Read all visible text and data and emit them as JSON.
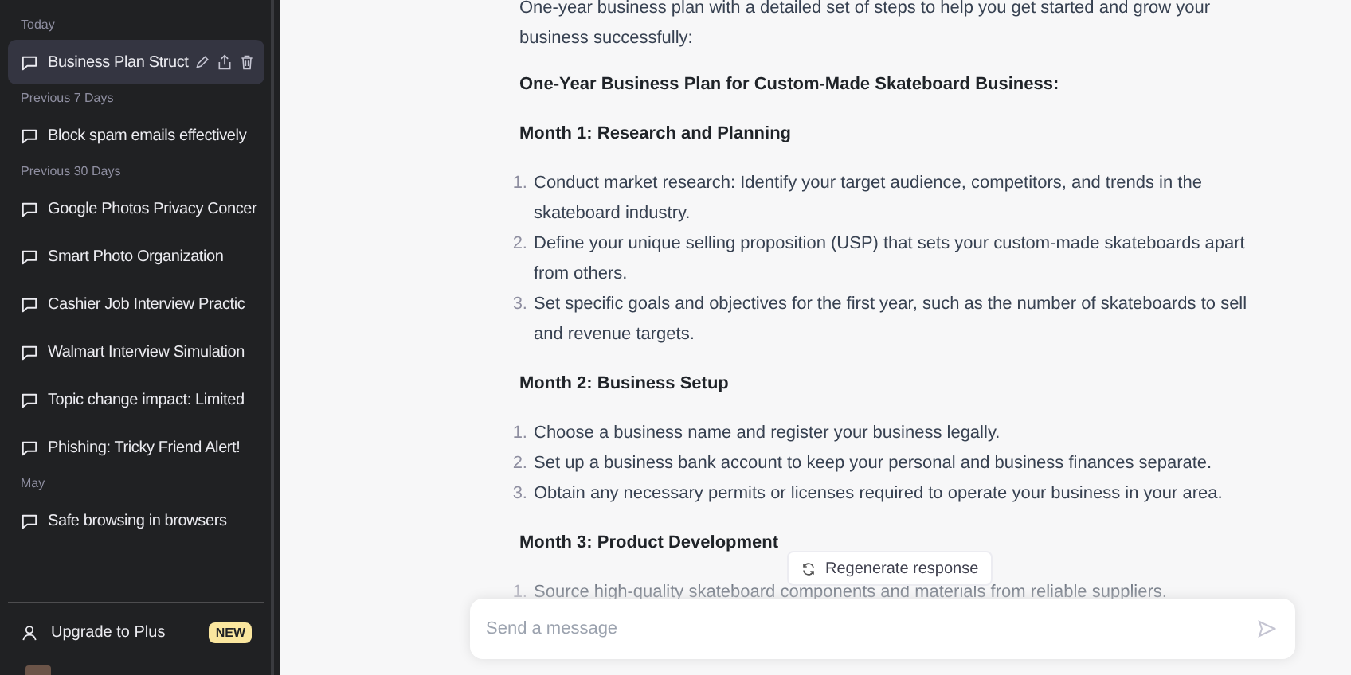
{
  "sidebar": {
    "sections": [
      {
        "label": "Today",
        "items": [
          {
            "title": "Business Plan Struct",
            "selected": true
          }
        ]
      },
      {
        "label": "Previous 7 Days",
        "items": [
          {
            "title": "Block spam emails effectively",
            "selected": false
          }
        ]
      },
      {
        "label": "Previous 30 Days",
        "items": [
          {
            "title": "Google Photos Privacy Concer",
            "selected": false
          },
          {
            "title": "Smart Photo Organization",
            "selected": false
          },
          {
            "title": "Cashier Job Interview Practic",
            "selected": false
          },
          {
            "title": "Walmart Interview Simulation",
            "selected": false
          },
          {
            "title": "Topic change impact: Limited",
            "selected": false
          },
          {
            "title": "Phishing: Tricky Friend Alert!",
            "selected": false
          }
        ]
      },
      {
        "label": "May",
        "items": [
          {
            "title": "Safe browsing in browsers",
            "selected": false
          }
        ]
      }
    ],
    "upgrade": {
      "label": "Upgrade to Plus",
      "badge": "NEW"
    }
  },
  "message": {
    "blocks": [
      {
        "kind": "paragraph",
        "text": "One-year business plan with a detailed set of steps to help you get started and grow your business successfully:"
      },
      {
        "kind": "heading",
        "text": "One-Year Business Plan for Custom-Made Skateboard Business:"
      },
      {
        "kind": "heading",
        "text": "Month 1: Research and Planning"
      },
      {
        "kind": "list",
        "items": [
          {
            "number": "1.",
            "text": "Conduct market research: Identify your target audience, competitors, and trends in the skateboard industry."
          },
          {
            "number": "2.",
            "text": "Define your unique selling proposition (USP) that sets your custom-made skateboards apart from others."
          },
          {
            "number": "3.",
            "text": "Set specific goals and objectives for the first year, such as the number of skateboards to sell and revenue targets."
          }
        ]
      },
      {
        "kind": "heading",
        "text": "Month 2: Business Setup"
      },
      {
        "kind": "list",
        "items": [
          {
            "number": "1.",
            "text": "Choose a business name and register your business legally."
          },
          {
            "number": "2.",
            "text": "Set up a business bank account to keep your personal and business finances separate."
          },
          {
            "number": "3.",
            "text": "Obtain any necessary permits or licenses required to operate your business in your area."
          }
        ]
      },
      {
        "kind": "heading",
        "text": "Month 3: Product Development"
      },
      {
        "kind": "list",
        "items": [
          {
            "number": "1.",
            "text": "Source high-quality skateboard components and materials from reliable suppliers."
          }
        ]
      }
    ]
  },
  "regenerate": {
    "label": "Regenerate response"
  },
  "composer": {
    "placeholder": "Send a message"
  }
}
